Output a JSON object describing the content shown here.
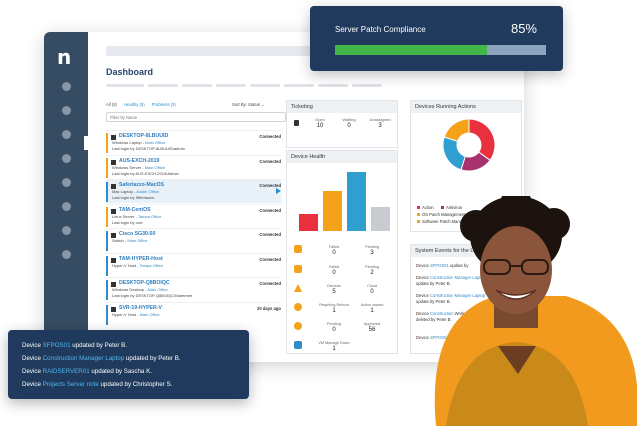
{
  "dashboard": {
    "title": "Dashboard"
  },
  "filters": {
    "all": "All (8)",
    "healthy": "Healthy (5)",
    "problems": "Problems (3)",
    "sort": "Sort By: Status",
    "placeholder": "Filter by Name"
  },
  "devices": [
    {
      "name": "DESKTOP-8LBUUID",
      "type": "Windows Laptop",
      "site": "Main Office",
      "login": "Last login by DESKTOP-8LBUUID\\admin",
      "status": "Connected",
      "color": "orange"
    },
    {
      "name": "AUS-EXCH-2019",
      "type": "Windows Server",
      "site": "Main Office",
      "login": "Last login by AUS-EXCH-2019\\Admin",
      "status": "Connected",
      "color": "orange"
    },
    {
      "name": "Saferlazzo-MacOS",
      "type": "Mac Laptop",
      "site": "Austin Office",
      "login": "Last login by Sfiferlazzo",
      "status": "Connected",
      "color": "blue"
    },
    {
      "name": "TAM-CentOS",
      "type": "Linux Server",
      "site": "Tampa Office",
      "login": "Last login by root",
      "status": "Connected",
      "color": "orange"
    },
    {
      "name": "Cisco SG30-50",
      "type": "Switch",
      "site": "Main Office",
      "login": "",
      "status": "Connected",
      "color": "blue"
    },
    {
      "name": "TAM-HYPER-Host",
      "type": "Hyper-V Host",
      "site": "Tampa Office",
      "login": "",
      "status": "Connected",
      "color": "blue"
    },
    {
      "name": "DESKTOP-Q8BOIQC",
      "type": "Windows Desktop",
      "site": "Main Office",
      "login": "Last login by DESKTOP-Q8BOIQC\\Maternee",
      "status": "Connected",
      "color": "blue"
    },
    {
      "name": "SVR-19-HYPER-V",
      "type": "Hyper-V Host",
      "site": "Main Office",
      "login": "",
      "status": "20 days ago",
      "color": "blue"
    }
  ],
  "ticketing": {
    "title": "Ticketing",
    "columns": [
      {
        "label": "Open",
        "value": "10"
      },
      {
        "label": "Waiting",
        "value": "0"
      },
      {
        "label": "Unassigned",
        "value": "3"
      }
    ]
  },
  "health": {
    "title": "Device Health",
    "bars": [
      {
        "value": 0.26,
        "color": "#e8303f"
      },
      {
        "value": 0.62,
        "color": "#f5a21b"
      },
      {
        "value": 0.92,
        "color": "#2f9fd0"
      },
      {
        "value": 0.38,
        "color": "#c8ccd0"
      }
    ],
    "stats": [
      {
        "label": "Failed",
        "value": "0"
      },
      {
        "label": "Pending",
        "value": "3"
      },
      {
        "label": "Failed",
        "value": "0"
      },
      {
        "label": "Pending",
        "value": "2"
      },
      {
        "label": "Devices",
        "value": "5"
      },
      {
        "label": "Cloud",
        "value": "0"
      },
      {
        "label": "Requiring Reboot",
        "value": "1"
      },
      {
        "label": "Action Issued",
        "value": "1"
      },
      {
        "label": "Pending",
        "value": "0"
      },
      {
        "label": "Approved",
        "value": "56"
      },
      {
        "label": "VM Manage Down",
        "value": "1"
      }
    ]
  },
  "actions": {
    "title": "Devices Running Actions",
    "slices": [
      {
        "value": 0.35,
        "color": "#e8303f"
      },
      {
        "value": 0.2,
        "color": "#a8326e"
      },
      {
        "value": 0.25,
        "color": "#2f9fd0"
      },
      {
        "value": 0.2,
        "color": "#f5a21b"
      }
    ],
    "legend": [
      {
        "label": "Action",
        "color": "#e8303f"
      },
      {
        "label": "Antivirus",
        "color": "#a8326e"
      },
      {
        "label": "OS Patch Management",
        "color": "#f5a21b"
      },
      {
        "label": "Team",
        "color": "#7b4b94"
      },
      {
        "label": "Software Patch Management",
        "color": "#f5a21b"
      }
    ]
  },
  "events": {
    "title": "System Events for the Last",
    "items": [
      {
        "prefix": "Device",
        "name": "SFPOS01",
        "suffix": "update by"
      },
      {
        "prefix": "Device",
        "name": "Construction Manager Laptop",
        "suffix": "update by Peter B."
      },
      {
        "prefix": "Device",
        "name": "Construction Manager Laptop",
        "suffix": "update by Peter B."
      },
      {
        "prefix": "Device",
        "name": "Construction",
        "suffix": "Workstation note deleted by Peter B."
      },
      {
        "prefix": "Device",
        "name": "SFPOS01",
        "suffix": "update by"
      }
    ]
  },
  "compliance": {
    "title": "Server Patch Compliance",
    "percent": "85%",
    "progress": 0.72
  },
  "activity": [
    {
      "prefix": "Device",
      "name": "SFPOS01",
      "suffix": "updated by Peter B."
    },
    {
      "prefix": "Device",
      "name": "Construction Manager Laptop",
      "suffix": "updated by Peter B."
    },
    {
      "prefix": "Device",
      "name": "RAIDSERVER01",
      "suffix": "updated by Sascha K."
    },
    {
      "prefix": "Device",
      "name": "Projects Server note",
      "suffix": "updated by  Christopher S."
    }
  ]
}
